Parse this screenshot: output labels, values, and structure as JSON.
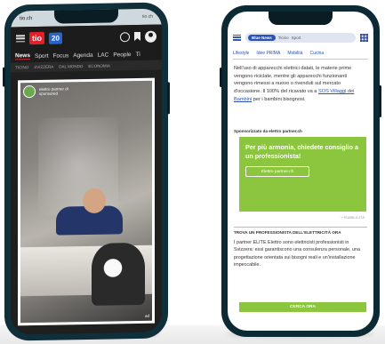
{
  "left_phone": {
    "status": {
      "label": "tio.ch",
      "url": "tio.ch"
    },
    "header": {
      "logo_main": "tio",
      "logo_secondary": "20"
    },
    "nav": [
      "News",
      "Sport",
      "Focus",
      "Agenda",
      "LAC",
      "People",
      "Ti"
    ],
    "subnav": [
      "TICINO",
      "SVIZZERA",
      "DAL MONDO",
      "ECONOMIA"
    ],
    "ad": {
      "sponsor_line1": "elettro partner di",
      "sponsor_line2": "sponsored",
      "corner_tag": "ad"
    }
  },
  "right_phone": {
    "tabs": {
      "selected": "Blue News",
      "others": [
        "Ticino",
        "Sport"
      ]
    },
    "subtabs": [
      "Lifestyle",
      "Idee PRIMA",
      "Mobilità",
      "Cucina"
    ],
    "article_text": "Nell'uso di apparecchi elettrici datati, le materie prime vengono riciclate, mentre gli apparecchi funzionanti vengono rimessi a nuovo o rivenduti sul mercato d'occasione. Il 100% del ricavato va a",
    "article_link": "SOS Villaggi dei Bambini",
    "article_tail": "per i bambini bisognosi.",
    "sponsor_label": "Sponsorizzato da elettro partner.ch",
    "sponsor_headline": "Per più armonia, chiedete consiglio a un professionista!",
    "sponsor_button": "Elettro partner.ch",
    "more_label": "+ PUBBLICITÀ",
    "section_title": "TROVA UN PROFESSIONISTA DELL'ELETTRICITÀ ORA",
    "section_body": "I partner ELITE Elettro sono elettricisti professionisti in Svizzera: essi garantiscono una consulenza personale, una progettazione orientata sui bisogni reali e un'installazione impeccabile.",
    "cta": "CERCA ORA"
  }
}
